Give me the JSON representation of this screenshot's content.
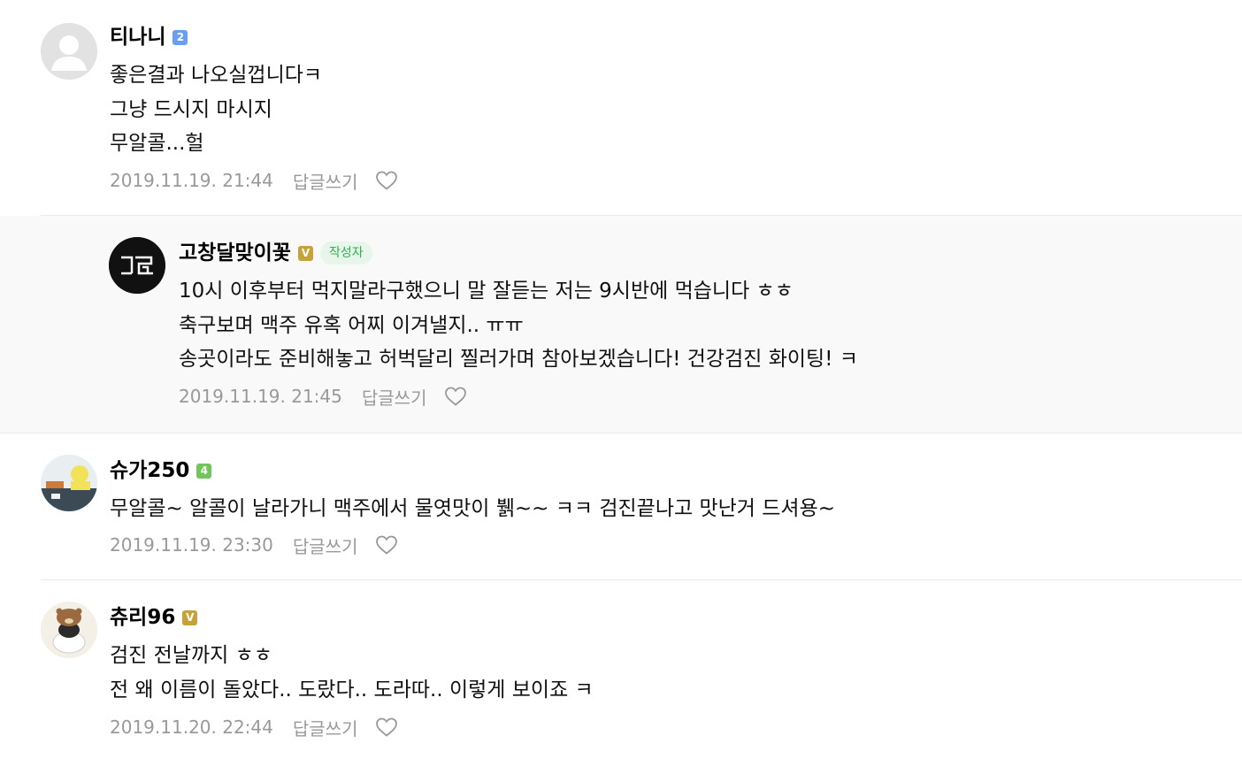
{
  "comments": [
    {
      "nickname": "티나니",
      "level": "2",
      "lines": [
        "좋은결과 나오실껍니다ㅋ",
        "그냥 드시지 마시지",
        "무알콜...헐"
      ],
      "date": "2019.11.19. 21:44",
      "reply_label": "답글쓰기",
      "like_icon": "heart-outline-icon"
    },
    {
      "nickname": "고창달맞이꽃",
      "level": "V",
      "author_badge": "작성자",
      "lines": [
        "10시 이후부터 먹지말라구했으니 말 잘듣는 저는 9시반에 먹습니다 ㅎㅎ",
        "축구보며 맥주 유혹 어찌 이겨낼지.. ㅠㅠ",
        "송곳이라도 준비해놓고 허벅달리 찔러가며 참아보겠습니다! 건강검진 화이팅! ㅋ"
      ],
      "date": "2019.11.19. 21:45",
      "reply_label": "답글쓰기",
      "like_icon": "heart-outline-icon"
    },
    {
      "nickname": "슈가250",
      "level": "4",
      "lines": [
        "무알콜~ 알콜이 날라가니 맥주에서 물엿맛이 뷁~~ ㅋㅋ 검진끝나고 맛난거 드셔용~"
      ],
      "date": "2019.11.19. 23:30",
      "reply_label": "답글쓰기",
      "like_icon": "heart-outline-icon"
    },
    {
      "nickname": "츄리96",
      "level": "V",
      "lines": [
        "검진 전날까지 ㅎㅎ",
        "전 왜 이름이 돌았다.. 도랐다.. 도라따.. 이렇게 보이죠 ㅋ"
      ],
      "date": "2019.11.20. 22:44",
      "reply_label": "답글쓰기",
      "like_icon": "heart-outline-icon"
    }
  ],
  "colors": {
    "level_blue": "#6b9ef0",
    "level_green": "#71c55a",
    "level_gold": "#c7a23a",
    "author_badge_text": "#2fb14f",
    "meta_gray": "#999999",
    "reply_background": "#f9f9fa"
  }
}
